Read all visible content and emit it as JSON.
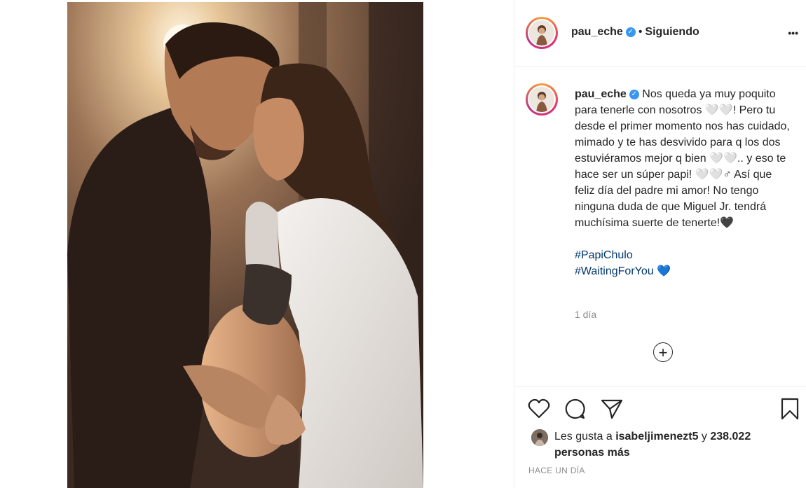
{
  "post": {
    "username": "pau_eche",
    "verified_mark": "✓",
    "separator": "•",
    "follow_status": "Siguiendo",
    "more_options": "•••",
    "caption_body": "Nos queda ya muy poquito para tenerle con nosotros 🤍🤍! Pero tu desde el primer momento nos has cuidado, mimado y te has desvivido para q los dos estuviéramos mejor q bien 🤍🤍.. y eso te hace ser un súper papi! 🤍🤍♂ Así que feliz día del padre mi amor! No tengo ninguna duda de que Miguel Jr. tendrá muchísima suerte de tenerte!🖤",
    "hashtags": [
      "#PapiChulo",
      "#WaitingForYou"
    ],
    "hashtag_heart": "💙",
    "relative_time": "1 día",
    "load_more": "+",
    "likes": {
      "prefix": "Les gusta a",
      "liker": "isabeljimenezt5",
      "joiner": "y",
      "count_text": "238.022 personas más"
    },
    "date_label": "HACE UN DÍA"
  },
  "icons": {
    "like": "heart-icon",
    "comment": "comment-icon",
    "share": "share-icon",
    "save": "bookmark-icon"
  },
  "colors": {
    "hashtag": "#00376b",
    "muted": "#8e8e8e",
    "verified": "#3897f0",
    "ring": "#e1306c"
  }
}
